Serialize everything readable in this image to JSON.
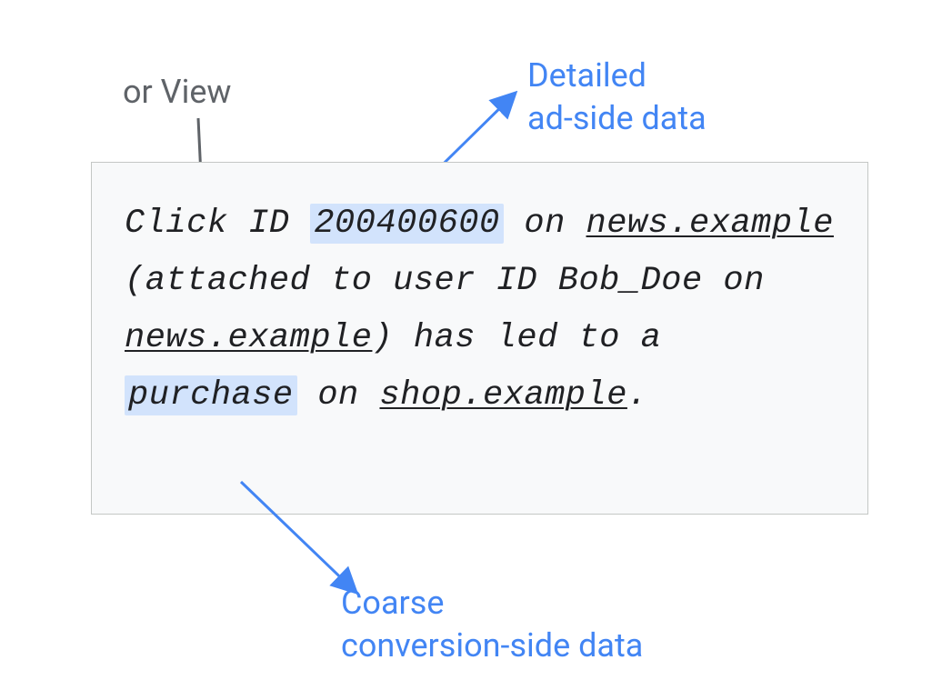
{
  "annotations": {
    "top_left": "or View",
    "top_right_line1": "Detailed",
    "top_right_line2": "ad-side data",
    "bottom_line1": "Coarse",
    "bottom_line2": "conversion-side data"
  },
  "text": {
    "part1": "Click ID ",
    "highlight1": "200400600",
    "part2": " on ",
    "underline1": "news.example",
    "part3": " (attached to user ID Bob_Doe on ",
    "underline2": "news.example",
    "part4": ") has led to a ",
    "highlight2": "purchase",
    "part5": " on ",
    "underline3": "shop.example",
    "part6": "."
  },
  "colors": {
    "gray": "#5f6368",
    "blue": "#4285f4",
    "dark": "#202124",
    "highlight_bg": "#d2e3fc",
    "box_bg": "#f8f9fa",
    "box_border": "#c4c7c5"
  }
}
